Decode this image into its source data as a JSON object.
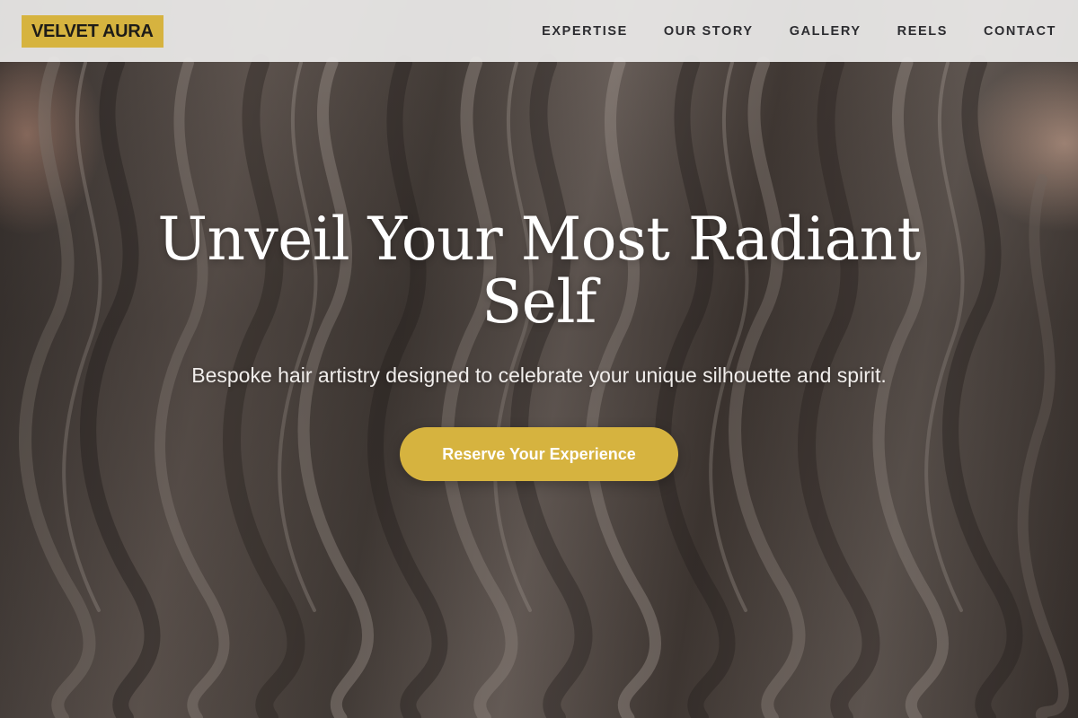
{
  "header": {
    "logo_text": "VELVET AURA",
    "nav": [
      {
        "label": "EXPERTISE"
      },
      {
        "label": "OUR STORY"
      },
      {
        "label": "GALLERY"
      },
      {
        "label": "REELS"
      },
      {
        "label": "CONTACT"
      }
    ]
  },
  "hero": {
    "background_image": "wavy-hair-photo",
    "title": "Unveil Your Most Radiant Self",
    "subtitle": "Bespoke hair artistry designed to celebrate your unique silhouette and spirit.",
    "cta_label": "Reserve Your Experience"
  },
  "colors": {
    "accent": "#d6b33f",
    "header_bg": "#ecebea",
    "nav_text": "#2c2c30",
    "hero_text": "#ffffff"
  }
}
